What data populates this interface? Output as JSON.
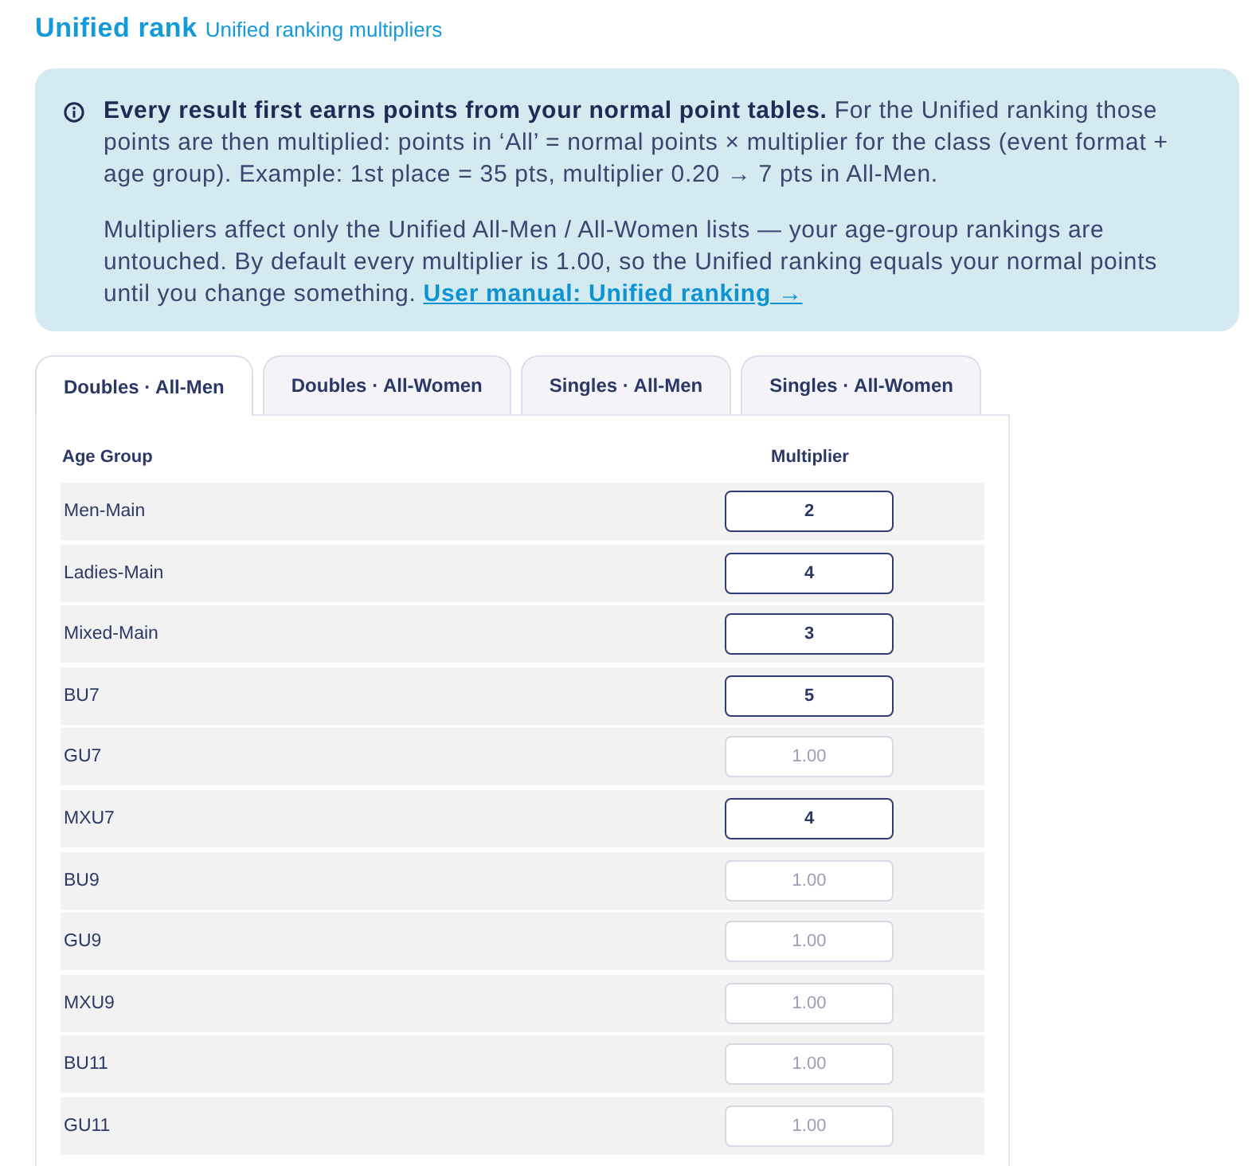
{
  "header": {
    "title": "Unified rank",
    "subtitle": "Unified ranking multipliers"
  },
  "info": {
    "paragraphs": [
      "**Every result first earns points from your normal point tables.** For the Unified ranking those points are then multiplied: points in ‘All’ = normal points × multiplier for the class (event format + age group). Example: 1st place = 35 pts, multiplier 0.20 → 7 pts in All-Men.",
      "Multipliers affect only the Unified All-Men / All-Women lists — your age-group rankings are untouched. By default every multiplier is 1.00, so the Unified ranking equals your normal points until you change something."
    ],
    "link": "User manual: Unified ranking →"
  },
  "tabs": [
    {
      "label": "Doubles · All-Men",
      "selected": true
    },
    {
      "label": "Doubles · All-Women",
      "selected": false
    },
    {
      "label": "Singles · All-Men",
      "selected": false
    },
    {
      "label": "Singles · All-Women",
      "selected": false
    }
  ],
  "table": {
    "columns": [
      "Age Group",
      "Multiplier"
    ],
    "rows": [
      {
        "age_group": "Men-Main",
        "value": "2"
      },
      {
        "age_group": "Ladies-Main",
        "value": "4"
      },
      {
        "age_group": "Mixed-Main",
        "value": "3"
      },
      {
        "age_group": "BU7",
        "value": "5"
      },
      {
        "age_group": "GU7",
        "placeholder": "1.00"
      },
      {
        "age_group": "MXU7",
        "value": "4"
      },
      {
        "age_group": "BU9",
        "placeholder": "1.00"
      },
      {
        "age_group": "GU9",
        "placeholder": "1.00"
      },
      {
        "age_group": "MXU9",
        "placeholder": "1.00"
      },
      {
        "age_group": "BU11",
        "placeholder": "1.00"
      },
      {
        "age_group": "GU11",
        "placeholder": "1.00"
      }
    ]
  }
}
